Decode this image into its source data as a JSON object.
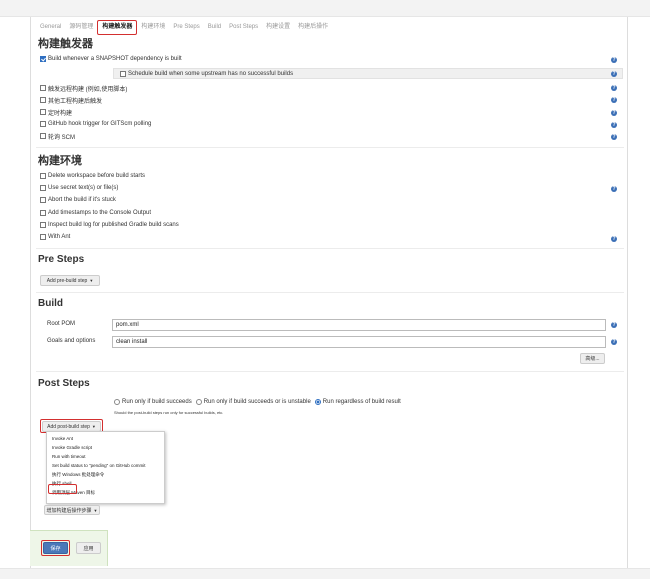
{
  "tabs": [
    "General",
    "源码管理",
    "构建触发器",
    "构建环境",
    "Pre Steps",
    "Build",
    "Post Steps",
    "构建设置",
    "构建后操作"
  ],
  "triggers": {
    "title": "构建触发器",
    "snapshot": "Build whenever a SNAPSHOT dependency is built",
    "schedule": "Schedule build when some upstream has no successful builds",
    "remote": "触发远程构建 (例如,使用脚本)",
    "after_other": "其他工程构建后触发",
    "periodic": "定时构建",
    "github_hook": "GitHub hook trigger for GITScm polling",
    "poll_scm": "轮询 SCM"
  },
  "env": {
    "title": "构建环境",
    "delete_ws": "Delete workspace before build starts",
    "secret": "Use secret text(s) or file(s)",
    "abort": "Abort the build if it's stuck",
    "timestamps": "Add timestamps to the Console Output",
    "gradle": "Inspect build log for published Gradle build scans",
    "ant": "With Ant"
  },
  "pre_steps": {
    "title": "Pre Steps",
    "add_button": "Add pre-build step"
  },
  "build": {
    "title": "Build",
    "root_pom_label": "Root POM",
    "root_pom_value": "pom.xml",
    "goals_label": "Goals and options",
    "goals_value": "clean install",
    "advanced_button": "高级..."
  },
  "post_steps": {
    "title": "Post Steps",
    "radio_success": "Run only if build succeeds",
    "radio_unstable": "Run only if build succeeds or is unstable",
    "radio_always": "Run regardless of build result",
    "note": "Should the post-build steps run only for successful builds, etc.",
    "add_button": "Add post-build step",
    "menu": [
      "Invoke Ant",
      "Invoke Gradle script",
      "Run with timeout",
      "Set build status to \"pending\" on GitHub commit",
      "执行 Windows 批处理命令",
      "执行 shell",
      "调用顶层 Maven 目标"
    ]
  },
  "post_build": {
    "add_button": "增加构建后操作步骤"
  },
  "footer": {
    "save": "保存",
    "apply": "应用"
  },
  "colors": {
    "highlight": "#d32f2f",
    "help_icon": "#3b6fb6",
    "save_panel": "#eef6e8"
  }
}
